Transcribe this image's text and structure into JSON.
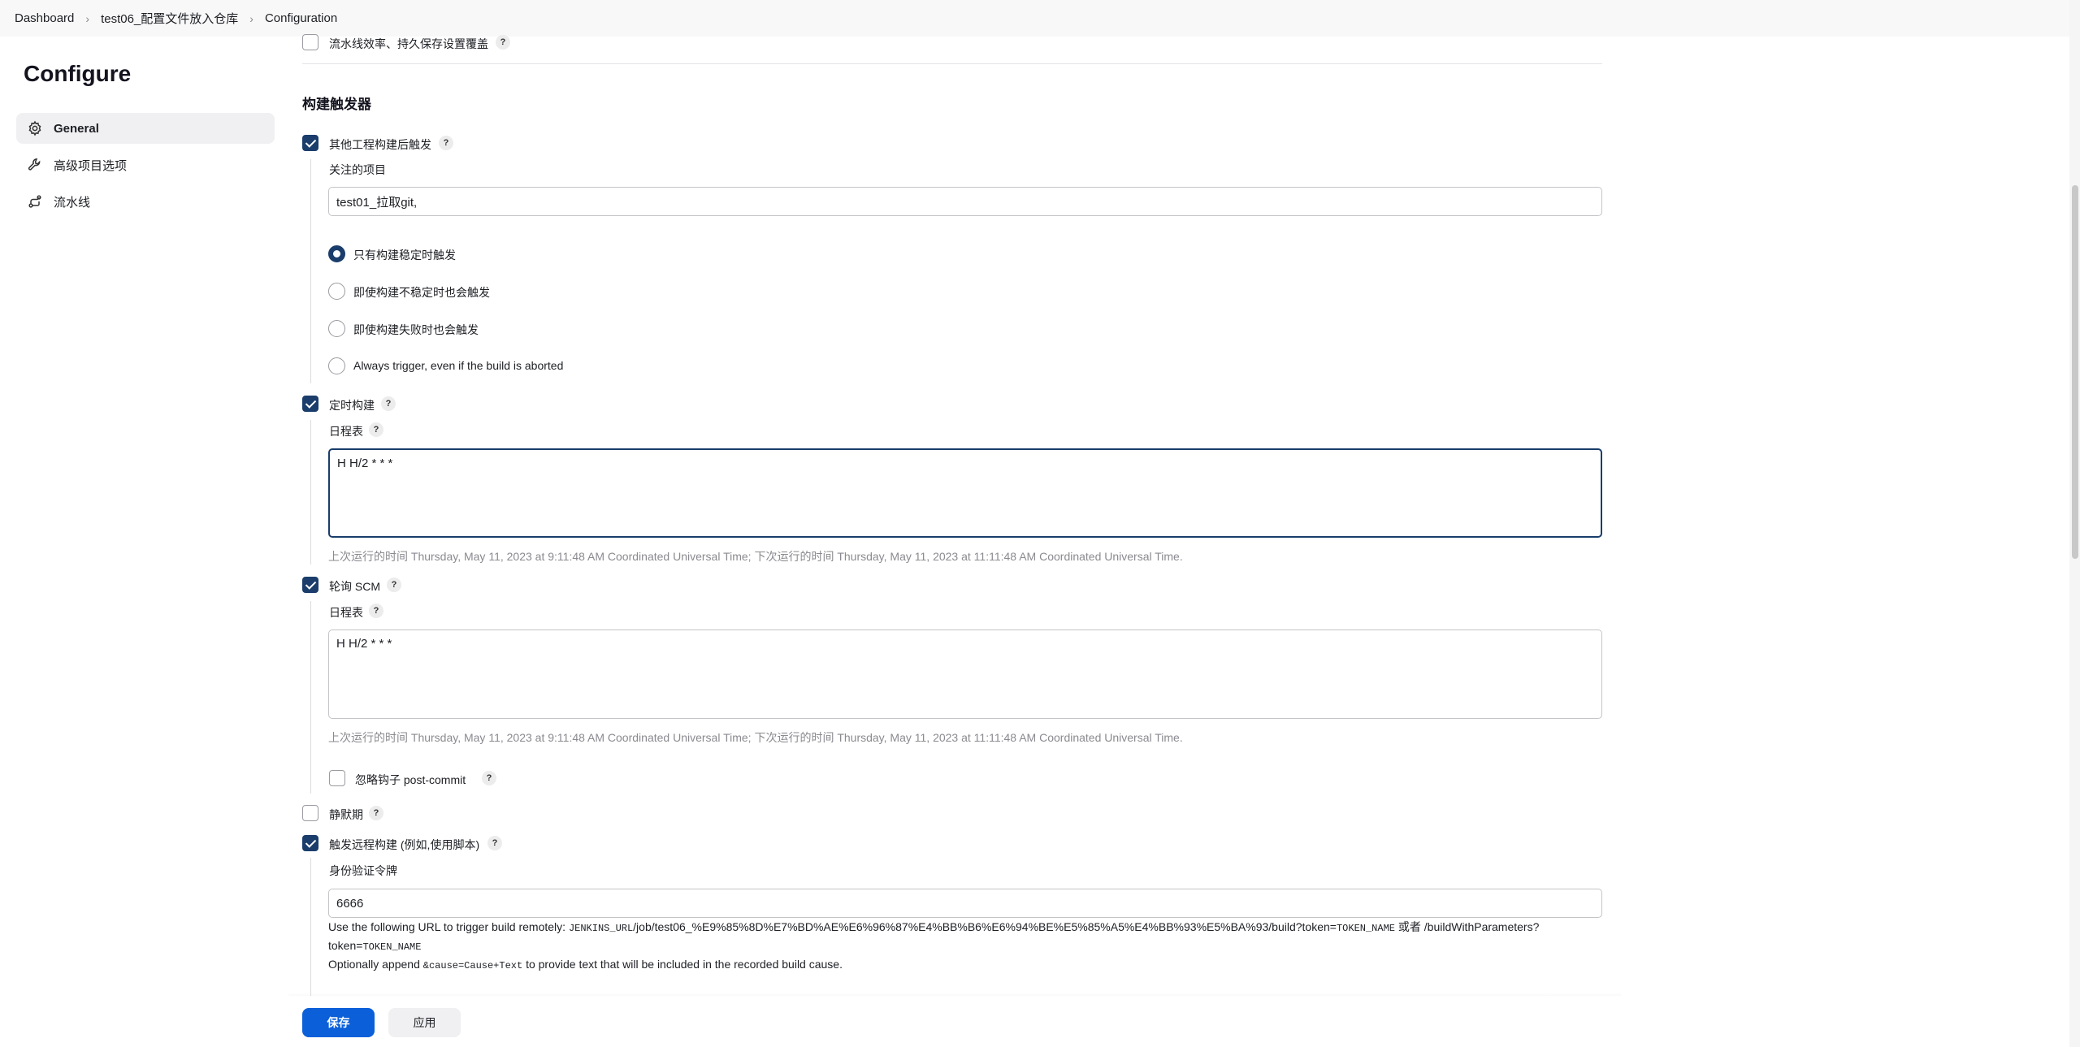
{
  "breadcrumb": {
    "items": [
      "Dashboard",
      "test06_配置文件放入仓库",
      "Configuration"
    ]
  },
  "sidebar": {
    "title": "Configure",
    "items": [
      {
        "label": "General",
        "icon": "gear-icon",
        "active": true
      },
      {
        "label": "高级项目选项",
        "icon": "wrench-icon",
        "active": false
      },
      {
        "label": "流水线",
        "icon": "pipeline-icon",
        "active": false
      }
    ]
  },
  "main": {
    "top_option": {
      "label": "流水线效率、持久保存设置覆盖",
      "checked": false
    },
    "triggers_title": "构建触发器",
    "upstream": {
      "label": "其他工程构建后触发",
      "checked": true,
      "projects_label": "关注的项目",
      "projects_value": "test01_拉取git,",
      "radios": [
        {
          "label": "只有构建稳定时触发",
          "checked": true
        },
        {
          "label": "即使构建不稳定时也会触发",
          "checked": false
        },
        {
          "label": "即使构建失败时也会触发",
          "checked": false
        },
        {
          "label": "Always trigger, even if the build is aborted",
          "checked": false
        }
      ]
    },
    "timer": {
      "label": "定时构建",
      "checked": true,
      "schedule_label": "日程表",
      "schedule_value": "H H/2 * * *",
      "hint": "上次运行的时间 Thursday, May 11, 2023 at 9:11:48 AM Coordinated Universal Time; 下次运行的时间 Thursday, May 11, 2023 at 11:11:48 AM Coordinated Universal Time."
    },
    "scm": {
      "label": "轮询 SCM",
      "checked": true,
      "schedule_label": "日程表",
      "schedule_value": "H H/2 * * *",
      "hint": "上次运行的时间 Thursday, May 11, 2023 at 9:11:48 AM Coordinated Universal Time; 下次运行的时间 Thursday, May 11, 2023 at 11:11:48 AM Coordinated Universal Time.",
      "ignore_hooks": {
        "label": "忽略钩子 post-commit",
        "checked": false
      }
    },
    "quiet": {
      "label": "静默期",
      "checked": false
    },
    "remote": {
      "label": "触发远程构建 (例如,使用脚本)",
      "checked": true,
      "token_label": "身份验证令牌",
      "token_value": "6666",
      "desc_prefix": "Use the following URL to trigger build remotely: ",
      "desc_var1": "JENKINS_URL",
      "desc_path": "/job/test06_%E9%85%8D%E7%BD%AE%E6%96%87%E4%BB%B6%E6%94%BE%E5%85%A5%E4%BB%93%E5%BA%93/build?token=",
      "desc_var2": "TOKEN_NAME",
      "desc_or": " 或者 /buildWithParameters?token=",
      "desc_var3": "TOKEN_NAME",
      "desc_line2_prefix": "Optionally append ",
      "desc_line2_code": "&cause=Cause+Text",
      "desc_line2_suffix": " to provide text that will be included in the recorded build cause."
    }
  },
  "footer": {
    "save_label": "保存",
    "apply_label": "应用"
  },
  "help_glyph": "?",
  "breadcrumb_sep": "›"
}
